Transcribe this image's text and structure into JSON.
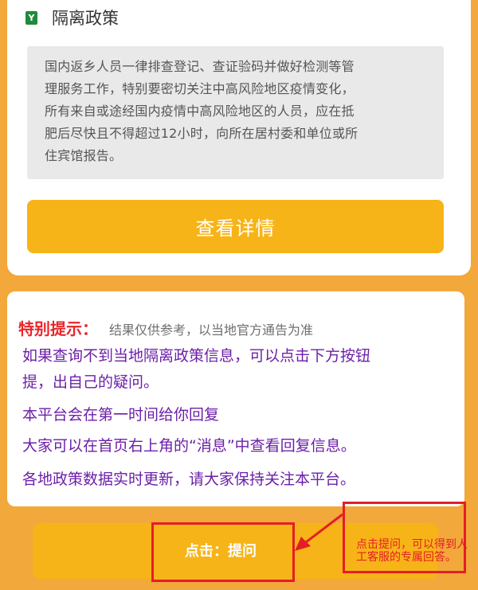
{
  "policy": {
    "icon_letter": "Y",
    "title": "隔离政策",
    "content_lines": [
      "国内返乡人员一律排查登记、查证验码并做好检测等管",
      "理服务工作，特别要密切关注中高风险地区疫情变化，",
      "所有来自或途经国内疫情中高风险地区的人员，应在抵",
      "肥后尽快且不得超过12小时，向所在居村委和单位或所",
      "住宾馆报告。"
    ],
    "detail_button_label": "查看详情"
  },
  "tip": {
    "label": "特别提示：",
    "note": "结果仅供参考，以当地官方通告为准",
    "lines": [
      "如果查询不到当地隔离政策信息，可以点击下方按钮",
      "提，出自己的疑问。",
      "本平台会在第一时间给你回复",
      "大家可以在首页右上角的“消息”中查看回复信息。",
      "各地政策数据实时更新，请大家保持关注本平台。"
    ]
  },
  "ask": {
    "label": "点击：提问"
  },
  "annotation": {
    "text": "点击提问，可以得到人工客服的专属回答。",
    "color": "#e41e26"
  },
  "colors": {
    "background": "#f2a83a",
    "button": "#f7b418",
    "tip_red": "#e8262a",
    "tip_purple": "#6c1fa8",
    "icon_green": "#1f8a3a"
  }
}
